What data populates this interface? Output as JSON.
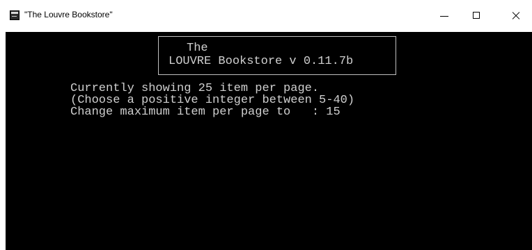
{
  "window": {
    "title": "\"The Louvre Bookstore\"",
    "app_icon": "console-icon",
    "controls": {
      "minimize_icon": "minimize-icon",
      "maximize_icon": "maximize-icon",
      "close_icon": "close-icon"
    }
  },
  "console": {
    "background": "#000000",
    "foreground": "#cfcfcf",
    "header": {
      "line1": "The",
      "line2": "LOUVRE Bookstore v 0.11.7b"
    },
    "messages": [
      "Currently showing 25 item per page.",
      "(Choose a positive integer between 5-40)"
    ],
    "prompt": {
      "label": "Change maximum item per page to   : ",
      "value": "15"
    }
  }
}
